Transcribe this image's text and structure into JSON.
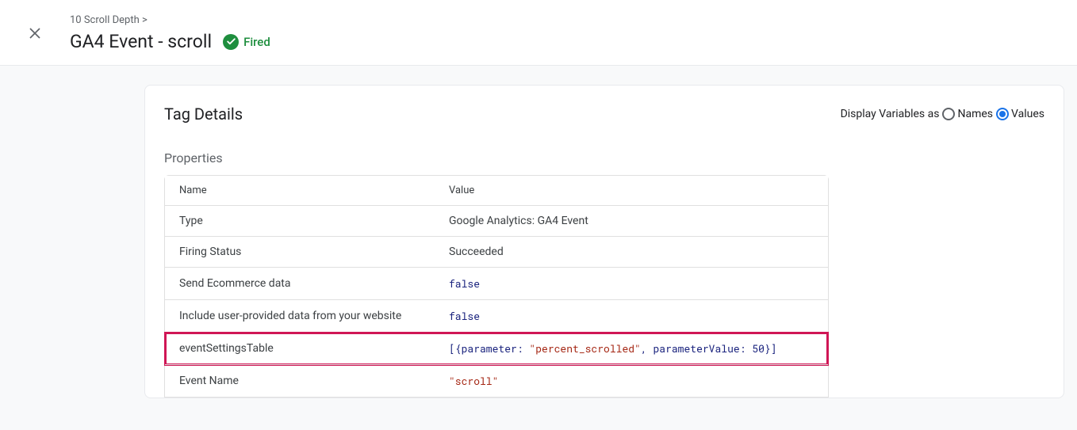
{
  "header": {
    "breadcrumb": "10 Scroll Depth >",
    "title": "GA4 Event - scroll",
    "status_label": "Fired"
  },
  "card": {
    "title": "Tag Details",
    "display_variables": {
      "label": "Display Variables as",
      "names_label": "Names",
      "values_label": "Values",
      "selected": "Values"
    },
    "properties_label": "Properties",
    "table": {
      "headers": {
        "name": "Name",
        "value": "Value"
      },
      "rows": [
        {
          "name": "Type",
          "value": "Google Analytics: GA4 Event",
          "code": false,
          "highlighted": false
        },
        {
          "name": "Firing Status",
          "value": "Succeeded",
          "code": false,
          "highlighted": false
        },
        {
          "name": "Send Ecommerce data",
          "value": "false",
          "code": true,
          "highlighted": false
        },
        {
          "name": "Include user-provided data from your website",
          "value": "false",
          "code": true,
          "highlighted": false
        },
        {
          "name": "eventSettingsTable",
          "value": "[{parameter: \"percent_scrolled\", parameterValue: 50}]",
          "code": true,
          "highlighted": true
        },
        {
          "name": "Event Name",
          "value": "\"scroll\"",
          "code": true,
          "highlighted": false
        }
      ]
    }
  }
}
